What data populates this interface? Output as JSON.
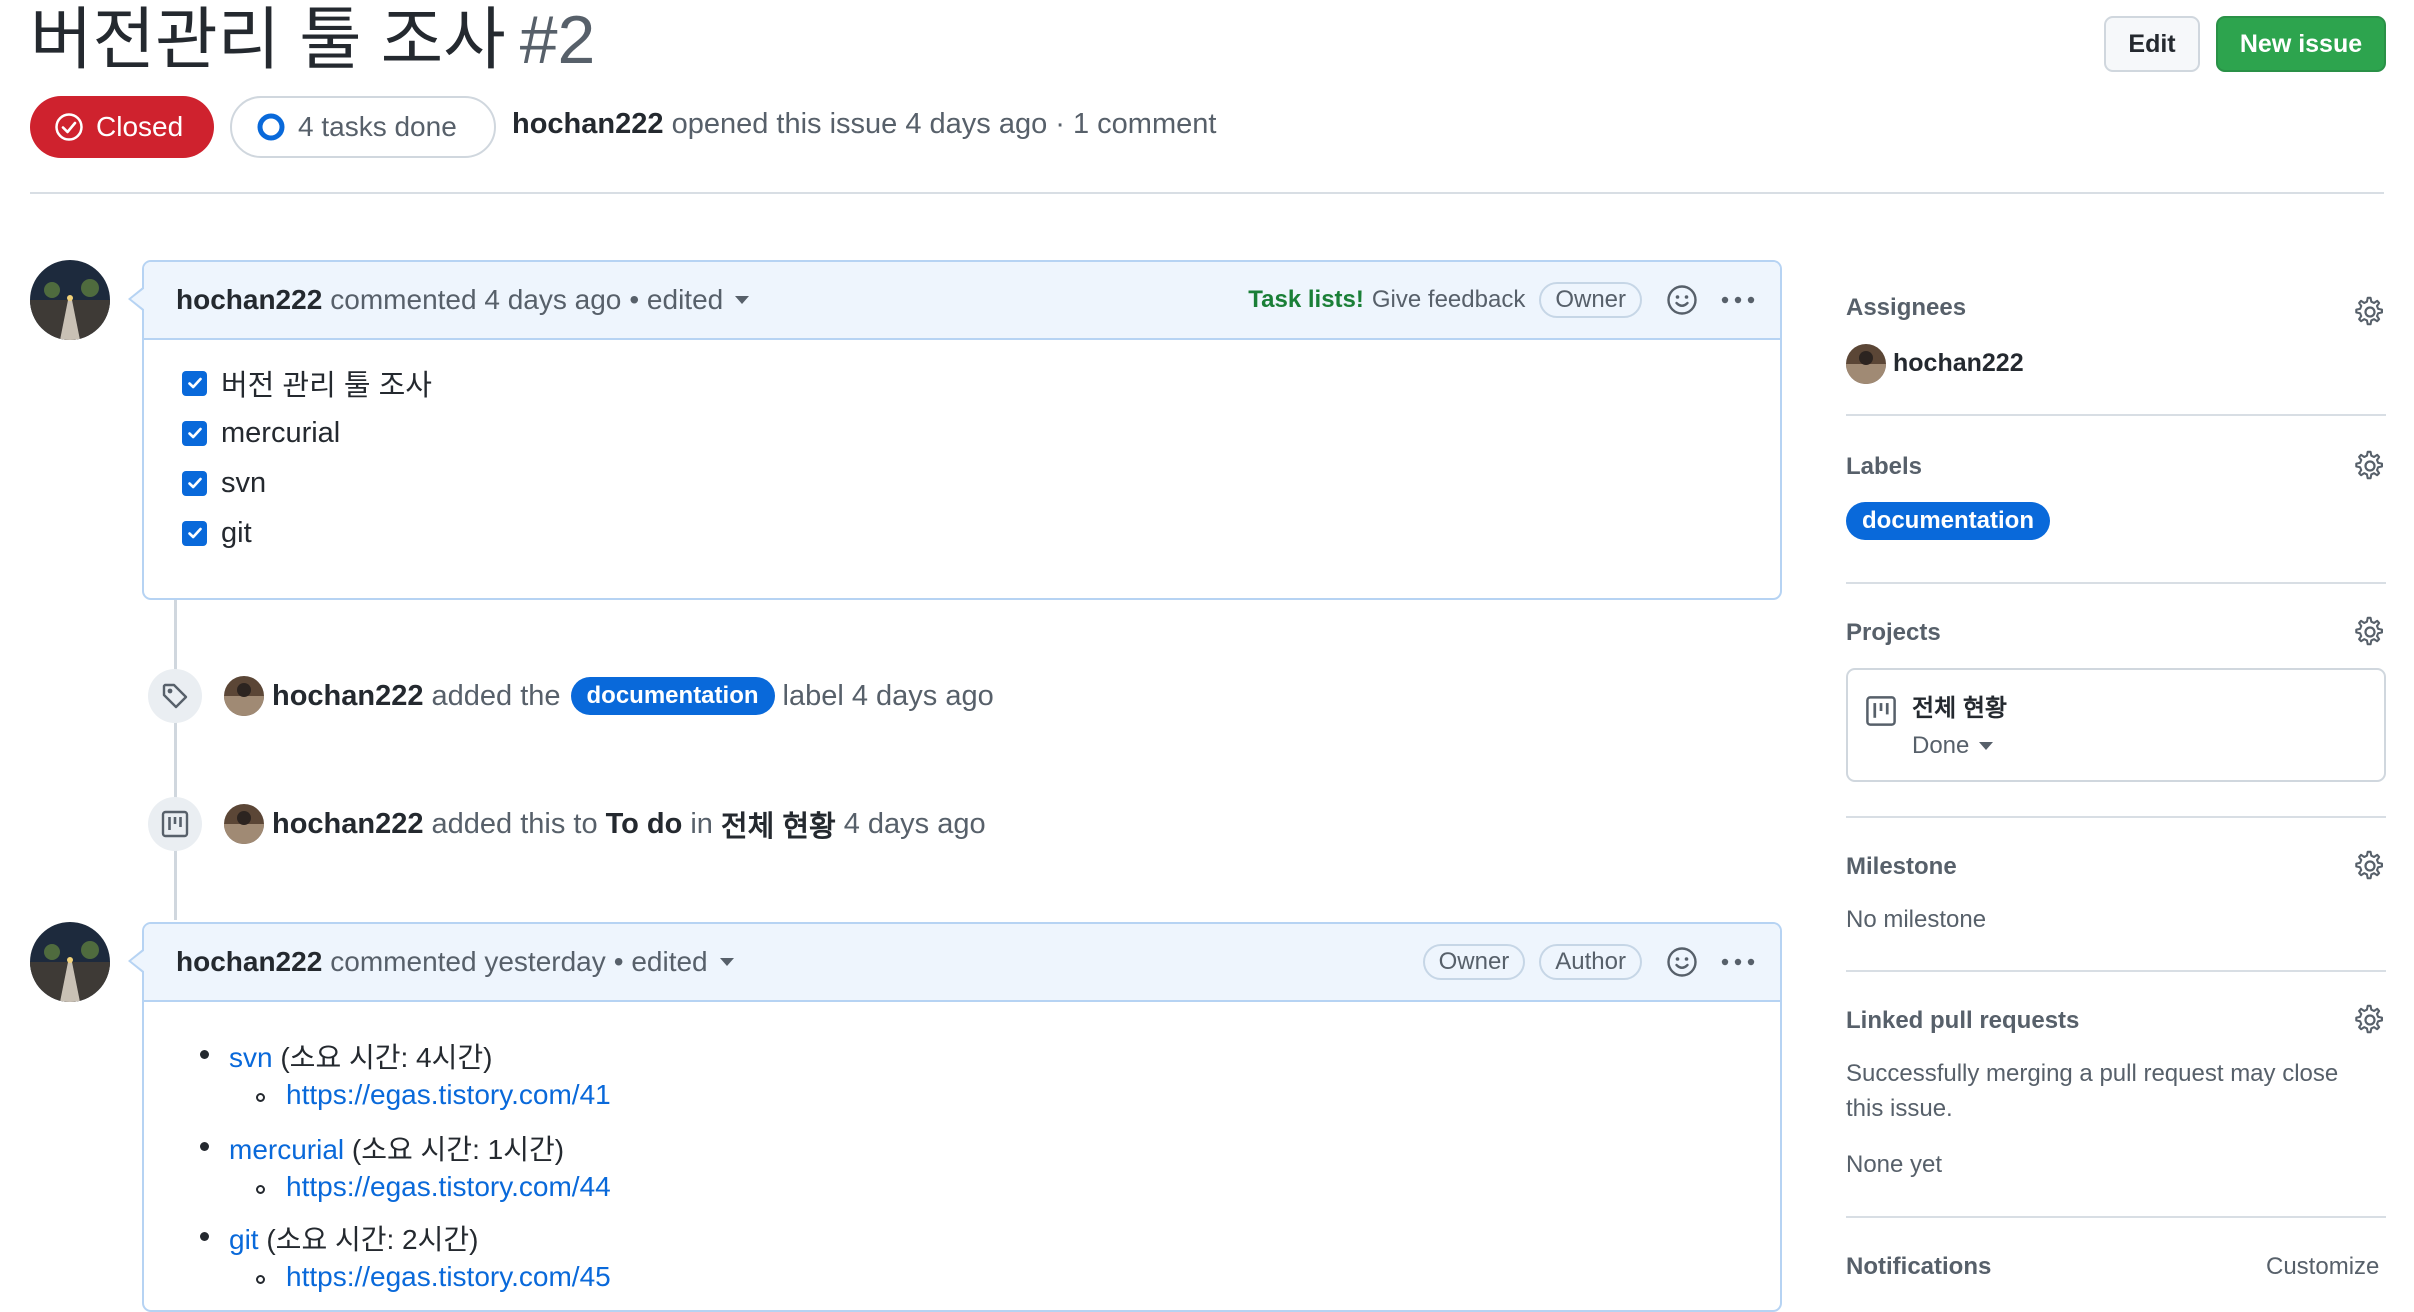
{
  "header": {
    "title": "버전관리 툴 조사",
    "number": "#2",
    "edit_label": "Edit",
    "new_issue_label": "New issue",
    "state_label": "Closed",
    "tasks_label": "4 tasks done",
    "meta": {
      "author": "hochan222",
      "opened_text": "opened this issue 4 days ago · 1 comment"
    }
  },
  "comment1": {
    "author": "hochan222",
    "action": "commented 4 days ago",
    "edited": "• edited",
    "task_lists": "Task lists!",
    "feedback": "Give feedback",
    "badge_owner": "Owner",
    "tasks": [
      "버전 관리 툴 조사",
      "mercurial",
      "svn",
      "git"
    ]
  },
  "event_label": {
    "actor": "hochan222",
    "pre": "added the",
    "label": "documentation",
    "post": "label 4 days ago"
  },
  "event_project": {
    "actor": "hochan222",
    "pre": "added this to",
    "column": "To do",
    "mid": "in",
    "project": "전체 현황",
    "post": "4 days ago"
  },
  "comment2": {
    "author": "hochan222",
    "action": "commented yesterday",
    "edited": "• edited",
    "badge_owner": "Owner",
    "badge_author": "Author",
    "items": [
      {
        "name": "svn",
        "time": "(소요 시간: 4시간)",
        "url": "https://egas.tistory.com/41"
      },
      {
        "name": "mercurial",
        "time": "(소요 시간: 1시간)",
        "url": "https://egas.tistory.com/44"
      },
      {
        "name": "git",
        "time": "(소요 시간: 2시간)",
        "url": "https://egas.tistory.com/45"
      }
    ]
  },
  "sidebar": {
    "assignees": {
      "heading": "Assignees",
      "user": "hochan222"
    },
    "labels": {
      "heading": "Labels",
      "label": "documentation"
    },
    "projects": {
      "heading": "Projects",
      "project": "전체 현황",
      "status": "Done"
    },
    "milestone": {
      "heading": "Milestone",
      "value": "No milestone"
    },
    "linked_prs": {
      "heading": "Linked pull requests",
      "desc_line1": "Successfully merging a pull request may close",
      "desc_line2": "this issue.",
      "value": "None yet"
    },
    "notifications": {
      "heading": "Notifications",
      "customize": "Customize"
    }
  },
  "colors": {
    "closed": "#cf222e",
    "primary": "#2da44e",
    "link": "#0969da",
    "label": "#0969da",
    "comment_header": "#eef5fd"
  }
}
